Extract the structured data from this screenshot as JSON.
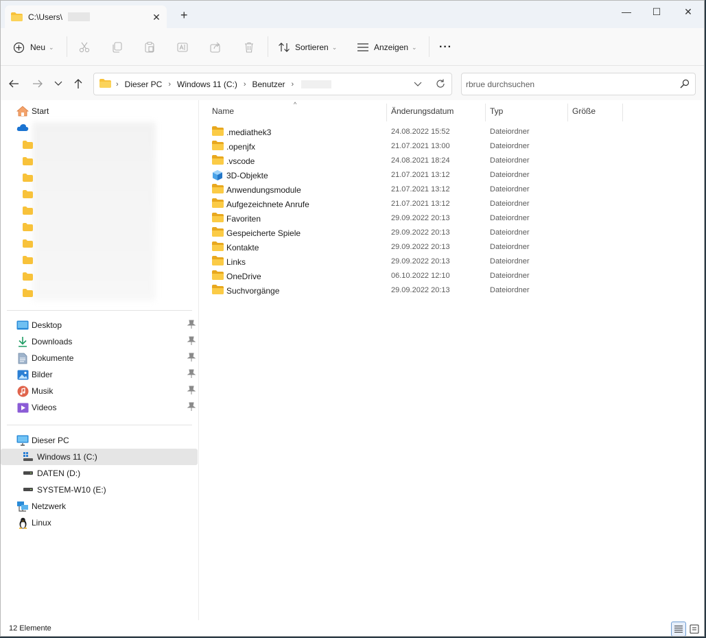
{
  "window": {
    "tab_title": "C:\\Users\\",
    "new_tab": "+",
    "minimize": "—",
    "maximize": "☐",
    "close": "✕",
    "tab_close": "✕"
  },
  "toolbar": {
    "new_label": "Neu",
    "sort_label": "Sortieren",
    "view_label": "Anzeigen",
    "more_label": "···"
  },
  "address": {
    "crumbs": [
      "Dieser PC",
      "Windows 11 (C:)",
      "Benutzer"
    ],
    "search_placeholder": "rbrue durchsuchen"
  },
  "sidebar": {
    "home": "Start",
    "quick": [
      {
        "label": "Desktop",
        "icon": "desktop-icon"
      },
      {
        "label": "Downloads",
        "icon": "downloads-icon"
      },
      {
        "label": "Dokumente",
        "icon": "documents-icon"
      },
      {
        "label": "Bilder",
        "icon": "pictures-icon"
      },
      {
        "label": "Musik",
        "icon": "music-icon"
      },
      {
        "label": "Videos",
        "icon": "videos-icon"
      }
    ],
    "this_pc": "Dieser PC",
    "drives": [
      {
        "label": "Windows 11 (C:)",
        "selected": true
      },
      {
        "label": "DATEN (D:)",
        "selected": false
      },
      {
        "label": "SYSTEM-W10 (E:)",
        "selected": false
      }
    ],
    "network": "Netzwerk",
    "linux": "Linux"
  },
  "columns": {
    "name": "Name",
    "date": "Änderungsdatum",
    "type": "Typ",
    "size": "Größe"
  },
  "files": [
    {
      "name": ".mediathek3",
      "date": "24.08.2022 15:52",
      "type": "Dateiordner",
      "icon": "folder-icon"
    },
    {
      "name": ".openjfx",
      "date": "21.07.2021 13:00",
      "type": "Dateiordner",
      "icon": "folder-icon"
    },
    {
      "name": ".vscode",
      "date": "24.08.2021 18:24",
      "type": "Dateiordner",
      "icon": "folder-icon"
    },
    {
      "name": "3D-Objekte",
      "date": "21.07.2021 13:12",
      "type": "Dateiordner",
      "icon": "3d-objects-icon"
    },
    {
      "name": "Anwendungsmodule",
      "date": "21.07.2021 13:12",
      "type": "Dateiordner",
      "icon": "folder-icon"
    },
    {
      "name": "Aufgezeichnete Anrufe",
      "date": "21.07.2021 13:12",
      "type": "Dateiordner",
      "icon": "folder-icon"
    },
    {
      "name": "Favoriten",
      "date": "29.09.2022 20:13",
      "type": "Dateiordner",
      "icon": "folder-icon"
    },
    {
      "name": "Gespeicherte Spiele",
      "date": "29.09.2022 20:13",
      "type": "Dateiordner",
      "icon": "folder-icon"
    },
    {
      "name": "Kontakte",
      "date": "29.09.2022 20:13",
      "type": "Dateiordner",
      "icon": "folder-icon"
    },
    {
      "name": "Links",
      "date": "29.09.2022 20:13",
      "type": "Dateiordner",
      "icon": "folder-icon"
    },
    {
      "name": "OneDrive",
      "date": "06.10.2022 12:10",
      "type": "Dateiordner",
      "icon": "folder-icon"
    },
    {
      "name": "Suchvorgänge",
      "date": "29.09.2022 20:13",
      "type": "Dateiordner",
      "icon": "folder-icon"
    }
  ],
  "status": {
    "count": "12 Elemente"
  },
  "colors": {
    "folder": "#f8c23a",
    "folder_dark": "#e5a91c",
    "accent": "#0067c0",
    "selected": "#e5e5e5"
  }
}
